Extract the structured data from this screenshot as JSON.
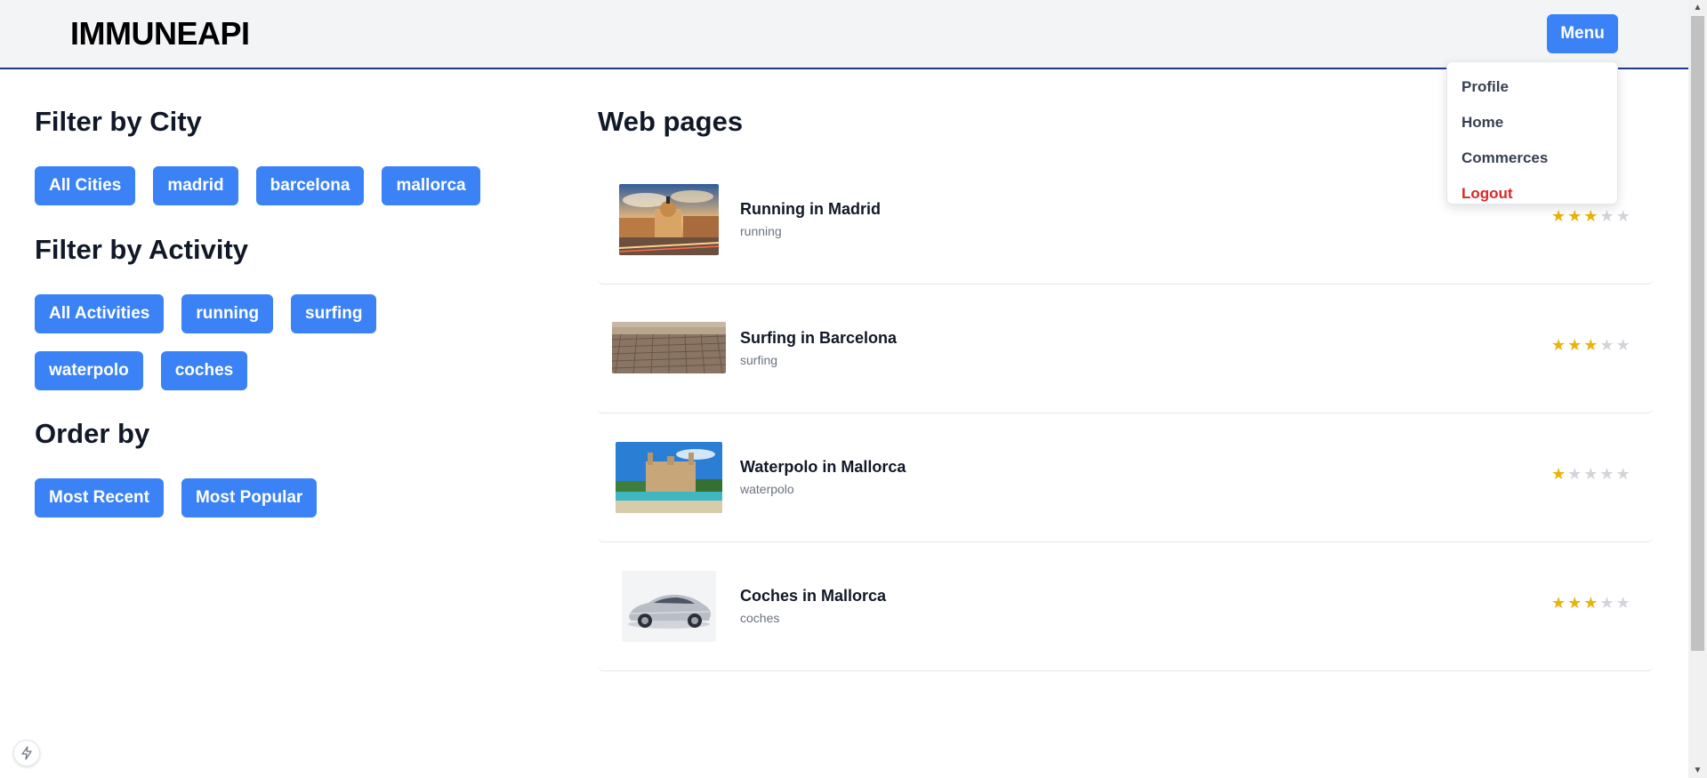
{
  "header": {
    "brand": "IMMUNEAPI",
    "menu_label": "Menu"
  },
  "dropdown": {
    "items": [
      {
        "label": "Profile"
      },
      {
        "label": "Home"
      },
      {
        "label": "Commerces"
      },
      {
        "label": "Logout"
      }
    ]
  },
  "filters": {
    "city": {
      "title": "Filter by City",
      "chips": [
        "All Cities",
        "madrid",
        "barcelona",
        "mallorca"
      ]
    },
    "activity": {
      "title": "Filter by Activity",
      "chips": [
        "All Activities",
        "running",
        "surfing",
        "waterpolo",
        "coches"
      ]
    },
    "order": {
      "title": "Order by",
      "chips": [
        "Most Recent",
        "Most Popular"
      ]
    }
  },
  "webpages": {
    "title": "Web pages",
    "items": [
      {
        "title": "Running in Madrid",
        "tag": "running",
        "rating": 3,
        "max": 5,
        "image": "madrid-street-photo"
      },
      {
        "title": "Surfing in Barcelona",
        "tag": "surfing",
        "rating": 3,
        "max": 5,
        "image": "barcelona-aerial-photo"
      },
      {
        "title": "Waterpolo in Mallorca",
        "tag": "waterpolo",
        "rating": 1,
        "max": 5,
        "image": "mallorca-cathedral-photo"
      },
      {
        "title": "Coches in Mallorca",
        "tag": "coches",
        "rating": 3,
        "max": 5,
        "image": "silver-car-photo"
      }
    ]
  },
  "colors": {
    "primary": "#3b82f6",
    "header_bg": "#f3f4f6",
    "header_border": "#1e3a8a",
    "star_on": "#eab308",
    "star_off": "#d1d5db",
    "danger": "#dc2626"
  },
  "icons": {
    "floating_badge": "bolt-icon"
  }
}
